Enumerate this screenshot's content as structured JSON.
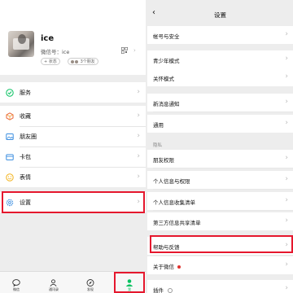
{
  "profile": {
    "name": "ice",
    "wechat_id": "微信号：ice",
    "status_tag": "+ 状态",
    "friends_tag": "3个朋友"
  },
  "menu": [
    {
      "label": "服务",
      "icon": "service-icon",
      "color": "#07c160"
    },
    {
      "label": "收藏",
      "icon": "favorites-icon",
      "color": "#e9663a"
    },
    {
      "label": "朋友圈",
      "icon": "moments-icon",
      "color": "#3d8fe0"
    },
    {
      "label": "卡包",
      "icon": "card-wallet-icon",
      "color": "#3d8fe0"
    },
    {
      "label": "表情",
      "icon": "emoji-icon",
      "color": "#f3b21a"
    },
    {
      "label": "设置",
      "icon": "settings-gear-icon",
      "color": "#3d8fe0"
    }
  ],
  "tabs": [
    {
      "label": "微信",
      "icon": "chat-bubble-icon"
    },
    {
      "label": "通讯录",
      "icon": "contacts-icon"
    },
    {
      "label": "发现",
      "icon": "compass-icon"
    },
    {
      "label": "我",
      "icon": "me-person-icon"
    }
  ],
  "settings": {
    "title": "设置",
    "privacy_header": "隐私",
    "items": [
      {
        "label": "帐号与安全"
      },
      {
        "label": "青少年模式"
      },
      {
        "label": "关怀模式"
      },
      {
        "label": "新消息通知"
      },
      {
        "label": "通用"
      },
      {
        "label": "朋友权限"
      },
      {
        "label": "个人信息与权限"
      },
      {
        "label": "个人信息收集清单"
      },
      {
        "label": "第三方信息共享清单"
      },
      {
        "label": "帮助与反馈"
      },
      {
        "label": "关于微信"
      },
      {
        "label": "插件"
      }
    ]
  },
  "colors": {
    "highlight": "#e5172d",
    "wechat_green": "#07c160",
    "badge_red": "#e0312d"
  }
}
